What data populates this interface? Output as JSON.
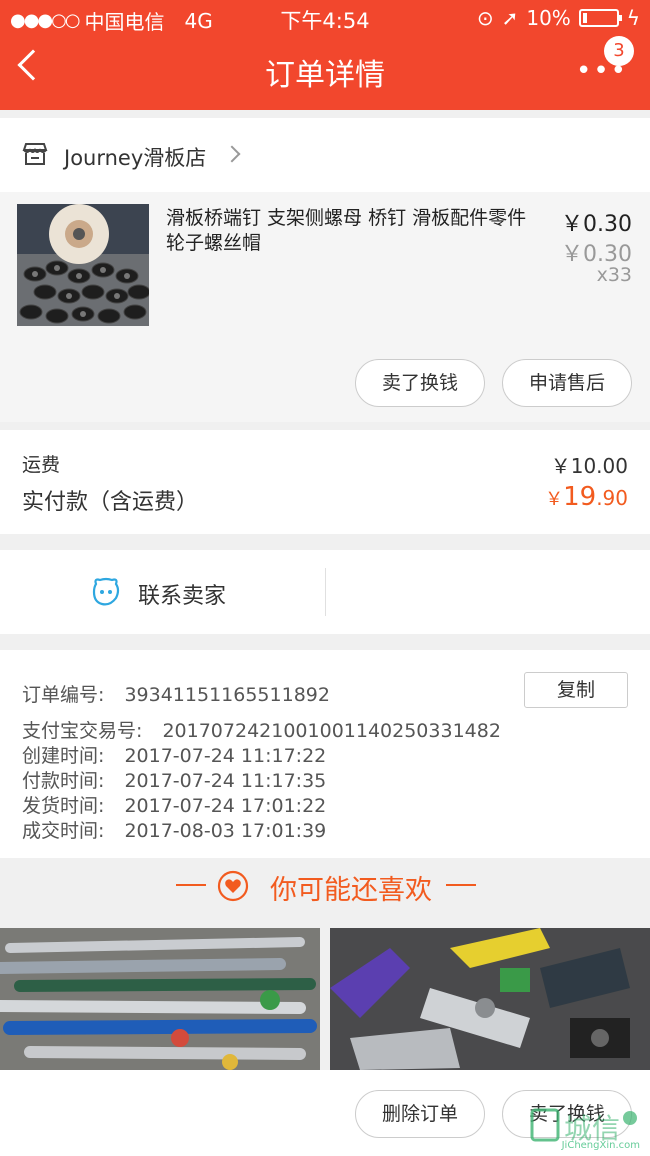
{
  "status_bar": {
    "carrier": "中国电信",
    "network": "4G",
    "time": "下午4:54",
    "battery": "10%"
  },
  "header": {
    "title": "订单详情",
    "badge_count": "3"
  },
  "shop": {
    "name": "Journey滑板店"
  },
  "product": {
    "name": "滑板桥端钉 支架侧螺母 桥钉 滑板配件零件 轮子螺丝帽",
    "price": "￥0.30",
    "original_price": "￥0.30",
    "quantity": "x33",
    "sell_button": "卖了换钱",
    "after_sale_button": "申请售后"
  },
  "fees": {
    "shipping_label": "运费",
    "shipping_value": "￥10.00",
    "paid_label": "实付款（含运费）",
    "paid_currency": "￥",
    "paid_integer": "19",
    "paid_decimal": ".90"
  },
  "contact": {
    "label": "联系卖家"
  },
  "order_info": {
    "order_no_label": "订单编号:",
    "order_no": "39341151165511892",
    "copy_button": "复制",
    "alipay_label": "支付宝交易号:",
    "alipay_no": "2017072421001001140250331482",
    "created_label": "创建时间:",
    "created": "2017-07-24 11:17:22",
    "paid_label": "付款时间:",
    "paid": "2017-07-24 11:17:35",
    "shipped_label": "发货时间:",
    "shipped": "2017-07-24 17:01:22",
    "completed_label": "成交时间:",
    "completed": "2017-08-03 17:01:39"
  },
  "recommend": {
    "title": "你可能还喜欢"
  },
  "bottom_bar": {
    "delete_button": "删除订单",
    "sell_button": "卖了换钱"
  },
  "watermark": {
    "text": "JiChengXin.com",
    "logo_text": "城信"
  },
  "colors": {
    "header_bg": "#f2472d",
    "price_accent": "#f25b1f",
    "contact_icon": "#2ea7e0"
  }
}
